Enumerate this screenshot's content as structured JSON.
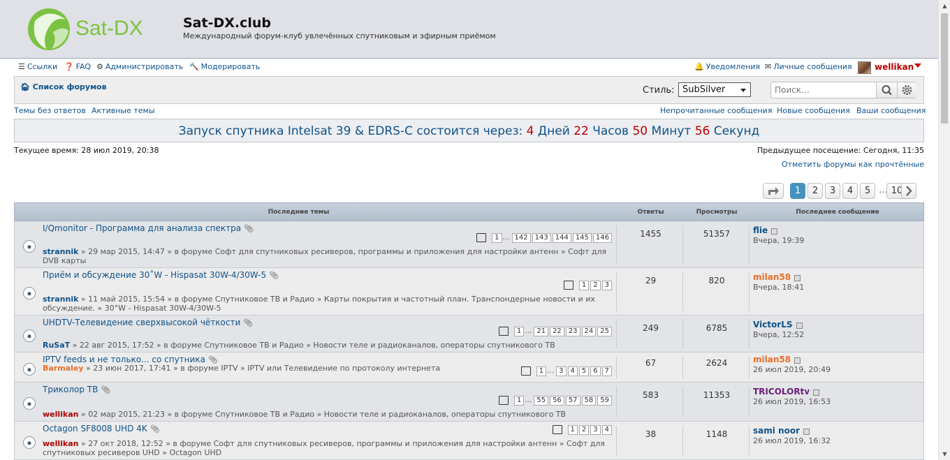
{
  "site": {
    "title": "Sat-DX.club",
    "description": "Международный форум-клуб увлечённых спутниковым и эфирным приёмом",
    "logo_text": "Sat-DX"
  },
  "nav": {
    "links": "Ссылки",
    "faq": "FAQ",
    "admin": "Администрировать",
    "moderate": "Модерировать",
    "notifications": "Уведомления",
    "pm": "Личные сообщения",
    "username": "wellikan"
  },
  "forumbar": {
    "forum_list": "Список форумов",
    "style_label": "Стиль:",
    "style_value": "SubSilver",
    "search_placeholder": "Поиск…"
  },
  "quicklinks": {
    "unanswered": "Темы без ответов",
    "active": "Активные темы",
    "unread": "Непрочитанные сообщения",
    "new": "Новые сообщения",
    "yours": "Ваши сообщения"
  },
  "countdown": {
    "prefix": "Запуск спутника Intelsat 39 & EDRS-C состоится через:",
    "days": "4",
    "days_label": "Дней",
    "hours": "22",
    "hours_label": "Часов",
    "minutes": "50",
    "minutes_label": "Минут",
    "seconds": "56",
    "seconds_label": "Секунд"
  },
  "times": {
    "current": "Текущее время: 28 июл 2019, 20:38",
    "previous": "Предыдущее посещение: Сегодня, 11:35",
    "mark_read": "Отметить форумы как прочтённые"
  },
  "pagination": {
    "pages": [
      "1",
      "2",
      "3",
      "4",
      "5",
      "…",
      "10"
    ],
    "active": "1"
  },
  "table": {
    "headers": {
      "topics": "Последние темы",
      "replies": "Ответы",
      "views": "Просмотры",
      "last_post": "Последнее сообщение"
    },
    "rows": [
      {
        "title": "I/Qmonitor - Программа для анализа спектра",
        "author": "strannik",
        "author_color": "#105289",
        "meta": " » 29 мар 2015, 14:47 » в форуме Софт для спутниковых ресиверов, программы и приложения для настройки антенн » Софт для DVB карты",
        "pages": [
          "1",
          "…",
          "142",
          "143",
          "144",
          "145",
          "146"
        ],
        "replies": "1455",
        "views": "51357",
        "last_author": "flie",
        "last_color": "#105289",
        "last_time": "Вчера, 19:39"
      },
      {
        "title": "Приём и обсуждение 30˚W - Hispasat 30W-4/30W-5",
        "author": "strannik",
        "author_color": "#105289",
        "meta": " » 11 май 2015, 15:54 » в форуме Спутниковое ТВ и Радио » Карты покрытия и частотный план. Транспондерные новости и их обсуждение. » 30°W - Hispasat 30W-4/30W-5",
        "pages": [
          "1",
          "2",
          "3"
        ],
        "replies": "29",
        "views": "820",
        "last_author": "milan58",
        "last_color": "#e8702a",
        "last_time": "Вчера, 18:41"
      },
      {
        "title": "UHDTV-Телевидение сверхвысокой чёткости",
        "author": "RuSaT",
        "author_color": "#105289",
        "meta": " » 22 авг 2015, 17:52 » в форуме Спутниковое ТВ и Радио » Новости теле и радиоканалов, операторы спутникового ТВ",
        "pages": [
          "1",
          "…",
          "21",
          "22",
          "23",
          "24",
          "25"
        ],
        "replies": "249",
        "views": "6785",
        "last_author": "VictorLS",
        "last_color": "#105289",
        "last_time": "Вчера, 12:52"
      },
      {
        "title": "IPTV feeds и не только... со спутника",
        "author": "Barmaley",
        "author_color": "#e8702a",
        "meta": " » 23 июн 2017, 17:41 » в форуме IPTV » IPTV или Телевидение по протоколу интернета",
        "pages": [
          "1",
          "…",
          "3",
          "4",
          "5",
          "6",
          "7"
        ],
        "replies": "67",
        "views": "2624",
        "last_author": "milan58",
        "last_color": "#e8702a",
        "last_time": "26 июл 2019, 20:49"
      },
      {
        "title": "Триколор ТВ",
        "author": "wellikan",
        "author_color": "#b00000",
        "meta": " » 02 мар 2015, 21:23 » в форуме Спутниковое ТВ и Радио » Новости теле и радиоканалов, операторы спутникового ТВ",
        "pages": [
          "1",
          "…",
          "55",
          "56",
          "57",
          "58",
          "59"
        ],
        "replies": "583",
        "views": "11353",
        "last_author": "TRICOLORtv",
        "last_color": "#6b1e78",
        "last_time": "26 июл 2019, 16:53"
      },
      {
        "title": "Octagon SF8008 UHD 4K",
        "author": "wellikan",
        "author_color": "#b00000",
        "meta": " » 27 окт 2018, 12:52 » в форуме Софт для спутниковых ресиверов, программы и приложения для настройки антенн » Софт для спутниковых ресиверов UHD » Octagon UHD",
        "pages": [
          "1",
          "2",
          "3",
          "4"
        ],
        "replies": "38",
        "views": "1148",
        "last_author": "sami noor",
        "last_color": "#105289",
        "last_time": "26 июл 2019, 16:32"
      }
    ]
  },
  "colors": {
    "link": "#105289",
    "accent_red": "#b00000",
    "pagination_active": "#4692bf"
  }
}
